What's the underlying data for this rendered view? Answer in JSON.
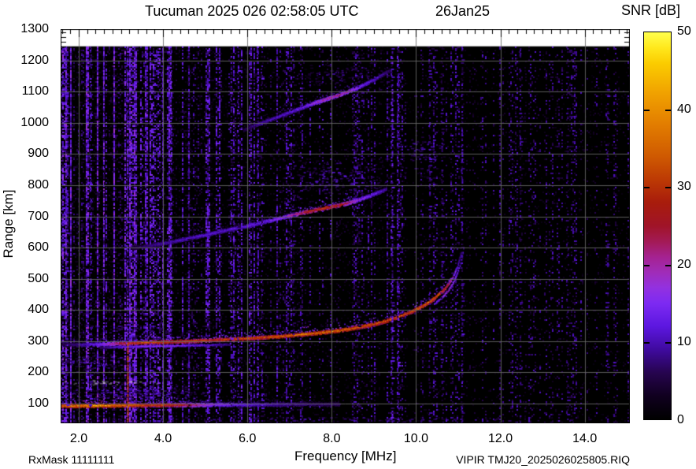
{
  "header": {
    "title": "Tucuman 2025 026 02:58:05 UTC",
    "date": "26Jan25",
    "colorbar_title": "SNR [dB]"
  },
  "footer": {
    "rx_mask": "RxMask 11111111",
    "file_id": "VIPIR  TMJ20_2025026025805.RIQ"
  },
  "chart_data": {
    "type": "heatmap",
    "subtype": "ionogram",
    "title": "Tucuman 2025 026 02:58:05 UTC 26Jan25",
    "xlabel": "Frequency [MHz]",
    "ylabel": "Range [km]",
    "zlabel": "SNR [dB]",
    "xlim": [
      1.57,
      15.07
    ],
    "ylim": [
      37,
      1300
    ],
    "data_ceiling_km": 1245,
    "xticks": [
      2,
      4,
      6,
      8,
      10,
      12,
      14
    ],
    "xtick_labels": [
      "2.0",
      "4.0",
      "6.0",
      "8.0",
      "10.0",
      "12.0",
      "14.0"
    ],
    "x_minor_step": 0.2,
    "yticks": [
      100,
      200,
      300,
      400,
      500,
      600,
      700,
      800,
      900,
      1000,
      1100,
      1200,
      1300
    ],
    "ytick_labels": [
      "100",
      "200",
      "300",
      "400",
      "500",
      "600",
      "700",
      "800",
      "900",
      "1000",
      "1100",
      "1200",
      "1300"
    ],
    "y_minor_ticks_km": [
      1245,
      1260,
      1275,
      1290
    ],
    "grid_on": true,
    "grid_color": "#6a6a6a",
    "background": "#000000",
    "seed": 20250126,
    "colorbar": {
      "range": [
        0,
        50
      ],
      "ticks": [
        0,
        10,
        20,
        30,
        40,
        50
      ],
      "tick_labels": [
        "0",
        "10",
        "20",
        "30",
        "40",
        "50"
      ],
      "stops": [
        [
          0,
          "#000000"
        ],
        [
          3,
          "#10001f"
        ],
        [
          6,
          "#26044e"
        ],
        [
          9,
          "#3f0a9e"
        ],
        [
          12,
          "#5c17e0"
        ],
        [
          15,
          "#7d2af2"
        ],
        [
          17,
          "#9331e0"
        ],
        [
          19,
          "#a02cb8"
        ],
        [
          21,
          "#a52290"
        ],
        [
          23,
          "#a31a55"
        ],
        [
          25,
          "#a01428"
        ],
        [
          28,
          "#a81c0c"
        ],
        [
          31,
          "#bd3a04"
        ],
        [
          34,
          "#cf5a01"
        ],
        [
          38,
          "#e27c00"
        ],
        [
          42,
          "#f0a000"
        ],
        [
          46,
          "#fbcc00"
        ],
        [
          48,
          "#ffe81c"
        ],
        [
          50,
          "#ffff4d"
        ]
      ]
    },
    "traces": [
      {
        "name": "E-layer-echo",
        "width": 2,
        "fuzz": 10,
        "fuzz_density": 0.5,
        "points": [
          [
            1.57,
            94,
            37
          ],
          [
            2.0,
            94,
            40
          ],
          [
            2.5,
            95,
            41
          ],
          [
            3.0,
            96,
            38
          ],
          [
            3.35,
            96,
            36
          ],
          [
            3.6,
            96,
            33
          ],
          [
            4.2,
            97,
            31
          ],
          [
            4.7,
            97,
            24
          ],
          [
            5.2,
            98,
            17
          ],
          [
            6.0,
            98,
            12
          ],
          [
            7.0,
            99,
            9
          ],
          [
            8.2,
            99,
            7
          ]
        ]
      },
      {
        "name": "F-trace-O",
        "width": 2,
        "fuzz": 9,
        "fuzz_density": 0.45,
        "points": [
          [
            1.57,
            291,
            6
          ],
          [
            2.0,
            290,
            9
          ],
          [
            2.4,
            291,
            14
          ],
          [
            2.8,
            293,
            22
          ],
          [
            3.2,
            295,
            30
          ],
          [
            3.7,
            298,
            33
          ],
          [
            4.2,
            300,
            33
          ],
          [
            4.7,
            302,
            32
          ],
          [
            5.2,
            305,
            31
          ],
          [
            5.7,
            308,
            33
          ],
          [
            6.2,
            312,
            34
          ],
          [
            6.7,
            316,
            35
          ],
          [
            7.2,
            322,
            37
          ],
          [
            7.7,
            328,
            38
          ],
          [
            8.2,
            336,
            37
          ],
          [
            8.6,
            345,
            36
          ],
          [
            9.0,
            356,
            35
          ],
          [
            9.3,
            367,
            35
          ],
          [
            9.6,
            381,
            33
          ],
          [
            9.9,
            397,
            33
          ],
          [
            10.15,
            414,
            35
          ],
          [
            10.35,
            431,
            36
          ],
          [
            10.5,
            447,
            35
          ],
          [
            10.65,
            466,
            30
          ],
          [
            10.78,
            488,
            24
          ],
          [
            10.88,
            512,
            18
          ],
          [
            10.97,
            540,
            13
          ],
          [
            11.03,
            568,
            9
          ],
          [
            11.08,
            592,
            7
          ]
        ]
      },
      {
        "name": "F-trace-X-low",
        "width": 1,
        "fuzz": 0,
        "fuzz_density": 0,
        "points": [
          [
            2.5,
            281,
            8
          ],
          [
            3.0,
            283,
            13
          ],
          [
            3.6,
            285,
            16
          ],
          [
            4.3,
            287,
            15
          ],
          [
            5.0,
            289,
            12
          ],
          [
            5.6,
            291,
            8
          ]
        ]
      },
      {
        "name": "F-trace-X-cusp",
        "width": 1,
        "fuzz": 0,
        "fuzz_density": 0,
        "points": [
          [
            10.42,
            420,
            13
          ],
          [
            10.6,
            441,
            17
          ],
          [
            10.75,
            463,
            20
          ],
          [
            10.87,
            489,
            18
          ],
          [
            10.97,
            519,
            15
          ],
          [
            11.05,
            552,
            12
          ],
          [
            11.1,
            585,
            10
          ],
          [
            11.13,
            615,
            7
          ]
        ]
      },
      {
        "name": "second-hop-trace",
        "width": 2,
        "fuzz": 12,
        "fuzz_density": 0.5,
        "points": [
          [
            3.25,
            599,
            5
          ],
          [
            3.6,
            606,
            8
          ],
          [
            4.0,
            615,
            10
          ],
          [
            4.5,
            628,
            11
          ],
          [
            5.0,
            642,
            12
          ],
          [
            5.5,
            657,
            12
          ],
          [
            6.0,
            671,
            13
          ],
          [
            6.5,
            687,
            14
          ],
          [
            6.9,
            700,
            18
          ],
          [
            7.2,
            710,
            25
          ],
          [
            7.5,
            719,
            29
          ],
          [
            7.8,
            727,
            30
          ],
          [
            8.1,
            735,
            29
          ],
          [
            8.35,
            743,
            24
          ],
          [
            8.6,
            753,
            18
          ],
          [
            8.85,
            765,
            15
          ],
          [
            9.1,
            778,
            12
          ],
          [
            9.3,
            789,
            9
          ]
        ]
      },
      {
        "name": "third-hop-trace",
        "width": 2,
        "fuzz": 9,
        "fuzz_density": 0.45,
        "points": [
          [
            5.9,
            978,
            6
          ],
          [
            6.2,
            995,
            9
          ],
          [
            6.6,
            1014,
            11
          ],
          [
            7.0,
            1035,
            12
          ],
          [
            7.4,
            1056,
            15
          ],
          [
            7.7,
            1070,
            20
          ],
          [
            8.0,
            1083,
            22
          ],
          [
            8.3,
            1097,
            21
          ],
          [
            8.6,
            1113,
            16
          ],
          [
            8.9,
            1133,
            12
          ],
          [
            9.15,
            1152,
            10
          ],
          [
            9.38,
            1170,
            7
          ]
        ]
      }
    ],
    "clouds": [
      {
        "name": "es-spread-low",
        "f0": 1.57,
        "f1": 5.0,
        "r0": 100,
        "r1": 162,
        "density": 0.5,
        "snr": 13
      },
      {
        "name": "es-patch-200km",
        "f0": 1.57,
        "f1": 3.15,
        "r0": 192,
        "r1": 260,
        "density": 0.45,
        "snr": 14
      },
      {
        "name": "es-streak-pale",
        "f0": 1.65,
        "f1": 3.85,
        "r0": 160,
        "r1": 176,
        "density": 0.75,
        "snr": 15,
        "color": "#c9bade"
      },
      {
        "name": "f-trace-halo",
        "f0": 2.0,
        "f1": 4.4,
        "r0": 300,
        "r1": 356,
        "density": 0.28,
        "snr": 11
      },
      {
        "name": "second-hop-spread",
        "f0": 6.9,
        "f1": 9.4,
        "r0": 735,
        "r1": 880,
        "density": 0.32,
        "snr": 13
      },
      {
        "name": "second-hop-cusp-spread",
        "f0": 9.55,
        "f1": 10.65,
        "r0": 800,
        "r1": 962,
        "density": 0.26,
        "snr": 12
      },
      {
        "name": "third-hop-spread",
        "f0": 7.3,
        "f1": 9.1,
        "r0": 1095,
        "r1": 1195,
        "density": 0.2,
        "snr": 10
      },
      {
        "name": "bottom-noise-band",
        "f0": 1.57,
        "f1": 15.05,
        "r0": 38,
        "r1": 58,
        "density": 0.25,
        "snr": 11
      }
    ],
    "rfi_lines": [
      {
        "f": 1.73,
        "density": 0.5,
        "snr": 12
      },
      {
        "f": 2.28,
        "density": 0.55,
        "snr": 13
      },
      {
        "f": 3.16,
        "density": 0.8,
        "snr": 15,
        "core": {
          "r1": 295,
          "snr": 31
        }
      },
      {
        "f": 4.62,
        "density": 0.35,
        "snr": 10
      },
      {
        "f": 5.62,
        "density": 0.6,
        "snr": 13
      },
      {
        "f": 5.79,
        "density": 0.55,
        "snr": 13
      },
      {
        "f": 6.35,
        "density": 0.5,
        "snr": 12
      },
      {
        "f": 7.1,
        "density": 0.35,
        "snr": 10
      },
      {
        "f": 8.65,
        "density": 0.3,
        "snr": 10
      },
      {
        "f": 9.44,
        "density": 0.7,
        "snr": 14
      },
      {
        "f": 9.58,
        "density": 0.6,
        "snr": 13
      },
      {
        "f": 10.33,
        "density": 0.45,
        "snr": 11
      },
      {
        "f": 10.62,
        "density": 0.35,
        "snr": 10
      },
      {
        "f": 11.1,
        "density": 0.4,
        "snr": 11
      },
      {
        "f": 12.48,
        "density": 0.3,
        "snr": 9
      },
      {
        "f": 13.6,
        "density": 0.28,
        "snr": 9
      },
      {
        "f": 14.55,
        "density": 0.3,
        "snr": 10
      }
    ],
    "noise_bands": [
      {
        "f0": 1.57,
        "f1": 2.6,
        "density": 0.58,
        "snr": 15
      },
      {
        "f0": 2.6,
        "f1": 3.35,
        "density": 0.52,
        "snr": 15
      },
      {
        "f0": 3.35,
        "f1": 4.2,
        "density": 0.4,
        "snr": 13
      },
      {
        "f0": 4.2,
        "f1": 5.15,
        "density": 0.34,
        "snr": 12
      },
      {
        "f0": 5.15,
        "f1": 6.25,
        "density": 0.3,
        "snr": 12
      },
      {
        "f0": 6.25,
        "f1": 7.3,
        "density": 0.27,
        "snr": 11
      },
      {
        "f0": 7.3,
        "f1": 8.6,
        "density": 0.22,
        "snr": 10
      },
      {
        "f0": 8.6,
        "f1": 9.4,
        "density": 0.2,
        "snr": 10
      },
      {
        "f0": 9.4,
        "f1": 9.7,
        "density": 0.24,
        "snr": 11
      },
      {
        "f0": 9.7,
        "f1": 10.15,
        "density": 0.1,
        "snr": 8
      },
      {
        "f0": 10.15,
        "f1": 11.35,
        "density": 0.17,
        "snr": 10
      },
      {
        "f0": 11.35,
        "f1": 12.6,
        "density": 0.15,
        "snr": 9
      },
      {
        "f0": 12.6,
        "f1": 15.07,
        "density": 0.14,
        "snr": 9
      }
    ]
  }
}
